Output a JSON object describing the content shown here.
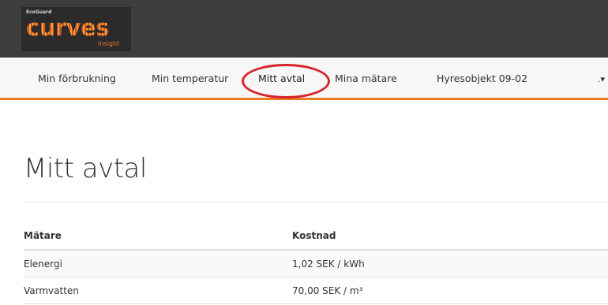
{
  "brand": {
    "company": "EcoGuard",
    "product": "curves",
    "tagline": "Insight"
  },
  "nav": {
    "items": [
      {
        "label": "Min förbrukning"
      },
      {
        "label": "Min temperatur"
      },
      {
        "label": "Mitt avtal",
        "active": true
      },
      {
        "label": "Mina mätare"
      },
      {
        "label": "Hyresobjekt 09-02"
      }
    ],
    "more_label": ".▾"
  },
  "page": {
    "title": "Mitt avtal"
  },
  "table": {
    "columns": [
      "Mätare",
      "Kostnad"
    ],
    "rows": [
      [
        "Elenergi",
        "1,02 SEK / kWh"
      ],
      [
        "Varmvatten",
        "70,00 SEK / m³"
      ]
    ]
  },
  "colors": {
    "accent": "#ef7b21",
    "highlight": "#d8232a",
    "header_bg": "#3d3d3d"
  }
}
